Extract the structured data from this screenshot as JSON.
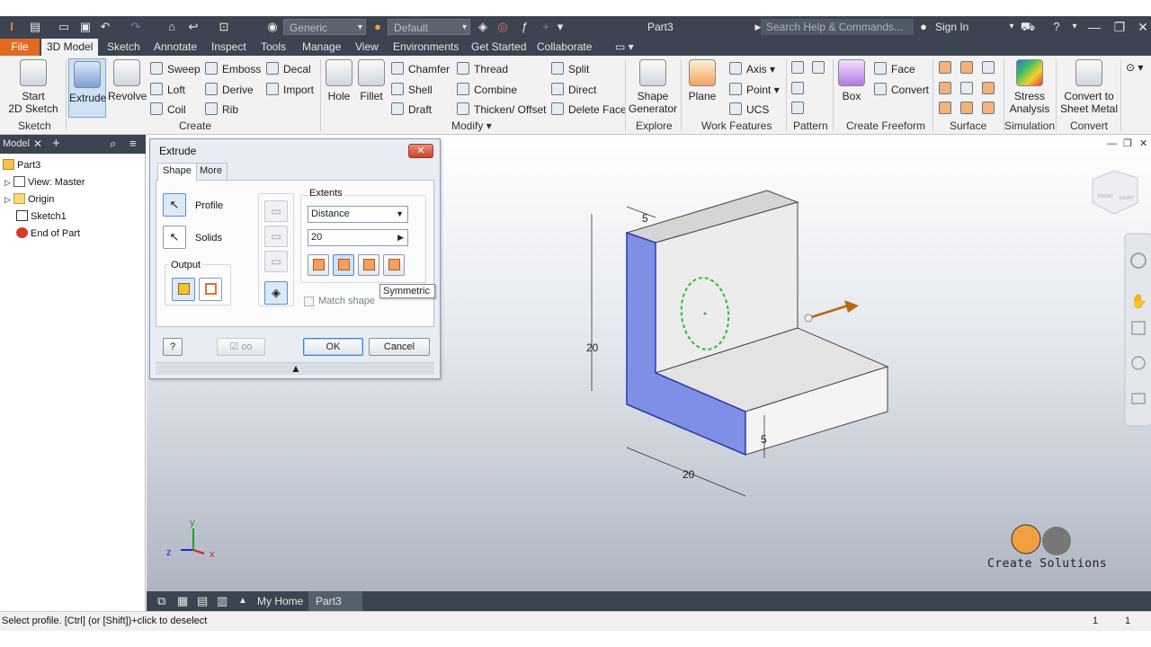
{
  "titlebar": {
    "doc_title": "Part3",
    "style_combo": "Generic",
    "appearance_combo": "Default",
    "search_placeholder": "Search Help & Commands...",
    "sign_in": "Sign In"
  },
  "tabs": [
    "File",
    "3D Model",
    "Sketch",
    "Annotate",
    "Inspect",
    "Tools",
    "Manage",
    "View",
    "Environments",
    "Get Started",
    "Collaborate"
  ],
  "ribbon": {
    "sketch": {
      "start_line1": "Start",
      "start_line2": "2D Sketch",
      "group": "Sketch"
    },
    "create": {
      "extrude": "Extrude",
      "revolve": "Revolve",
      "sweep": "Sweep",
      "loft": "Loft",
      "coil": "Coil",
      "emboss": "Emboss",
      "derive": "Derive",
      "rib": "Rib",
      "decal": "Decal",
      "import": "Import",
      "group": "Create"
    },
    "modify": {
      "hole": "Hole",
      "fillet": "Fillet",
      "chamfer": "Chamfer",
      "shell": "Shell",
      "draft": "Draft",
      "thread": "Thread",
      "combine": "Combine",
      "thicken": "Thicken/ Offset",
      "split": "Split",
      "direct": "Direct",
      "delete_face": "Delete Face",
      "group": "Modify"
    },
    "explore": {
      "shape_line1": "Shape",
      "shape_line2": "Generator",
      "group": "Explore"
    },
    "work_features": {
      "plane": "Plane",
      "axis": "Axis",
      "point": "Point",
      "ucs": "UCS",
      "group": "Work Features"
    },
    "pattern": {
      "group": "Pattern"
    },
    "freeform": {
      "box": "Box",
      "face": "Face",
      "convert": "Convert",
      "group": "Create Freeform"
    },
    "surface": {
      "group": "Surface"
    },
    "simulation": {
      "stress_line1": "Stress",
      "stress_line2": "Analysis",
      "group": "Simulation"
    },
    "convert": {
      "line1": "Convert to",
      "line2": "Sheet Metal",
      "group": "Convert"
    }
  },
  "browser": {
    "title": "Model",
    "items": [
      "Part3",
      "View: Master",
      "Origin",
      "Sketch1",
      "End of Part"
    ]
  },
  "dialog": {
    "title": "Extrude",
    "tabs": [
      "Shape",
      "More"
    ],
    "profile": "Profile",
    "solids": "Solids",
    "output": "Output",
    "extents": "Extents",
    "extent_type": "Distance",
    "distance": "20",
    "match_shape": "Match shape",
    "ok": "OK",
    "cancel": "Cancel",
    "tooltip": "Symmetric"
  },
  "model_dimensions": {
    "top_thickness": "5",
    "height": "20",
    "bottom_thickness": "5",
    "width": "20"
  },
  "axes": {
    "x": "x",
    "y": "y",
    "z": "z"
  },
  "viewcube": {
    "front": "FRONT",
    "right": "RIGHT"
  },
  "doc_tabs": {
    "home": "My Home",
    "part": "Part3"
  },
  "status": {
    "text": "Select profile. [Ctrl] (or [Shift])+click to deselect",
    "count1": "1",
    "count2": "1"
  },
  "watermark": {
    "text": "Create Solutions"
  },
  "colors": {
    "accent": "#e06a20",
    "profile_face": "#7f8fe6",
    "sketch_circle": "#2fbf2f",
    "dark_chrome": "#3b4450"
  }
}
